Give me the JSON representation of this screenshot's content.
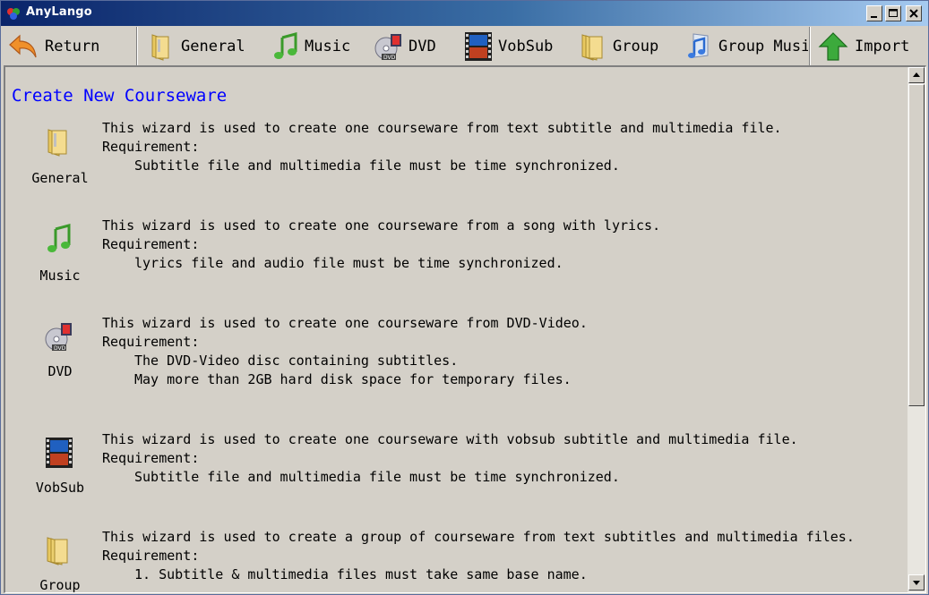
{
  "window": {
    "title": "AnyLango"
  },
  "toolbar": {
    "return_label": "Return",
    "general_label": "General",
    "music_label": "Music",
    "dvd_label": "DVD",
    "vobsub_label": "VobSub",
    "group_label": "Group",
    "group_music_label": "Group Musi",
    "import_label": "Import"
  },
  "content": {
    "heading": "Create New Courseware",
    "requirement_label": "Requirement:",
    "wizards": [
      {
        "name": "General",
        "icon": "folder-icon",
        "description": "This wizard is used to create one courseware from text subtitle and multimedia file.",
        "requirements": [
          "Subtitle file and multimedia file must be time synchronized."
        ]
      },
      {
        "name": "Music",
        "icon": "music-note-icon",
        "description": "This wizard is used to create one courseware from a song with lyrics.",
        "requirements": [
          "lyrics file and audio file must be time synchronized."
        ]
      },
      {
        "name": "DVD",
        "icon": "dvd-icon",
        "description": "This wizard is used to create one courseware from DVD-Video.",
        "requirements": [
          "The DVD-Video disc containing subtitles.",
          "May more than 2GB hard disk space for temporary files."
        ]
      },
      {
        "name": "VobSub",
        "icon": "film-icon",
        "description": "This wizard is used to create one courseware with vobsub subtitle and multimedia file.",
        "requirements": [
          "Subtitle file and multimedia file must be time synchronized."
        ]
      },
      {
        "name": "Group",
        "icon": "folder-icon",
        "description": "This wizard is used to create a group of courseware from text subtitles and multimedia files.",
        "requirements": [
          "1. Subtitle & multimedia files must take same base name."
        ]
      }
    ]
  }
}
